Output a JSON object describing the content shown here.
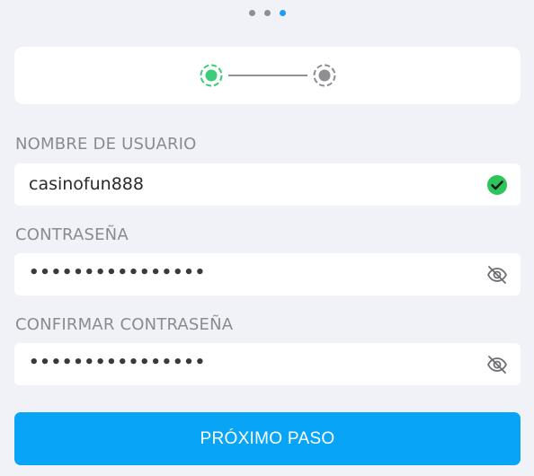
{
  "pager": {
    "total": 3,
    "active_index": 2
  },
  "stepper": {
    "steps": 2,
    "current_step": 1,
    "colors": {
      "done": "#3dcc7a",
      "pending": "#8e8e93",
      "line": "#6e6e73"
    }
  },
  "form": {
    "username": {
      "label": "NOMBRE DE USUARIO",
      "value": "casinofun888",
      "status_icon": "check-circle-icon"
    },
    "password": {
      "label": "CONTRASEÑA",
      "value": "••••••••••••••••",
      "toggle_icon": "eye-off-icon"
    },
    "confirm_password": {
      "label": "CONFIRMAR CONTRASEÑA",
      "value": "••••••••••••••••",
      "toggle_icon": "eye-off-icon"
    }
  },
  "next_button": {
    "label": "PRÓXIMO PASO",
    "color": "#08a5f7"
  }
}
